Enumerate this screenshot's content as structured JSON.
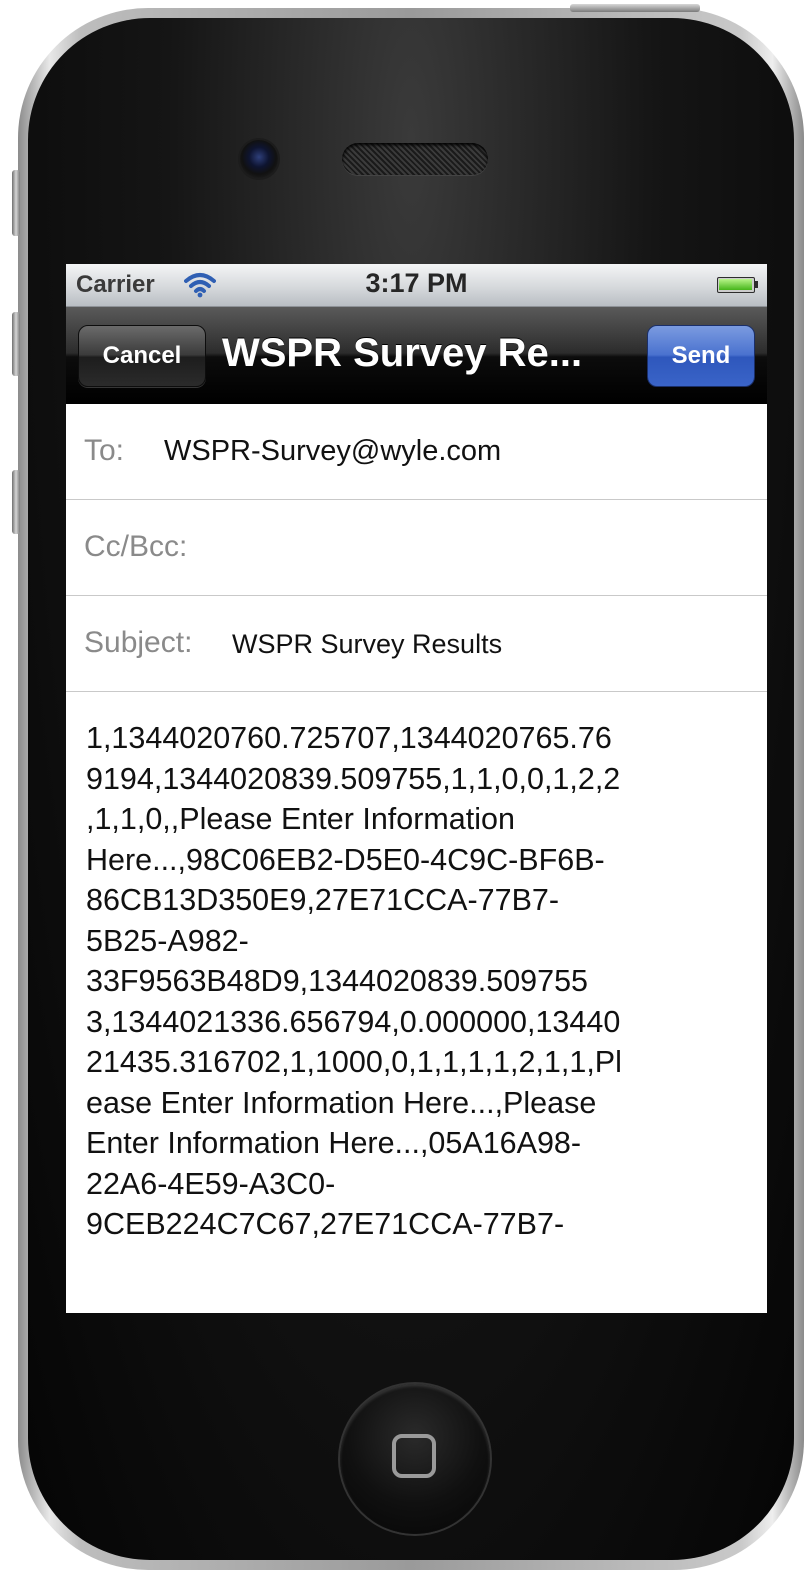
{
  "status_bar": {
    "carrier": "Carrier",
    "time": "3:17 PM",
    "wifi_icon": "wifi-icon",
    "battery_icon": "battery-icon",
    "battery_color": "#46b51a"
  },
  "nav_bar": {
    "cancel_label": "Cancel",
    "title": "WSPR Survey Re...",
    "send_label": "Send",
    "send_color": "#3a64c8"
  },
  "compose": {
    "to_label": "To:",
    "to_value": "WSPR-Survey@wyle.com",
    "ccbcc_label": "Cc/Bcc:",
    "ccbcc_value": "",
    "subject_label": "Subject:",
    "subject_value": "WSPR Survey Results",
    "body": "1,1344020760.725707,1344020765.76\n9194,1344020839.509755,1,1,0,0,1,2,2\n,1,1,0,,Please Enter Information\nHere...,98C06EB2-D5E0-4C9C-BF6B-\n86CB13D350E9,27E71CCA-77B7-\n5B25-A982-\n33F9563B48D9,1344020839.509755\n3,1344021336.656794,0.000000,13440\n21435.316702,1,1000,0,1,1,1,1,2,1,1,Pl\nease Enter Information Here...,Please\nEnter Information Here...,05A16A98-\n22A6-4E59-A3C0-\n9CEB224C7C67,27E71CCA-77B7-"
  },
  "device": {
    "camera_icon": "camera-icon",
    "speaker_icon": "speaker-grille-icon",
    "home_icon": "home-button-icon"
  }
}
